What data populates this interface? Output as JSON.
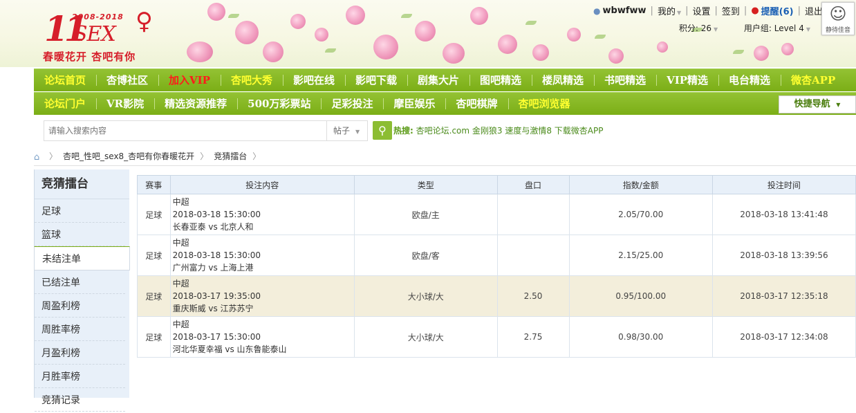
{
  "header": {
    "logo_number": "11",
    "logo_years": "2008-2018",
    "logo_text": "SEX",
    "slogan": "春暖花开 杏吧有你",
    "user": {
      "username": "wbwfww",
      "my_label": "我的",
      "settings_label": "设置",
      "checkin_label": "签到",
      "remind_label": "提醒(6)",
      "logout_label": "退出",
      "points": "积分: 26",
      "group": "用户组: Level 4",
      "avatar_caption": "静待佳音"
    }
  },
  "nav_primary": [
    {
      "label": "论坛首页",
      "color": "yellow"
    },
    {
      "label": "杏博社区",
      "color": "white"
    },
    {
      "label": "加入VIP",
      "color": "red"
    },
    {
      "label": "杏吧大秀",
      "color": "yellow"
    },
    {
      "label": "影吧在线",
      "color": "white"
    },
    {
      "label": "影吧下载",
      "color": "white"
    },
    {
      "label": "剧集大片",
      "color": "white"
    },
    {
      "label": "图吧精选",
      "color": "white"
    },
    {
      "label": "楼凤精选",
      "color": "white"
    },
    {
      "label": "书吧精选",
      "color": "white"
    },
    {
      "label": "VIP精选",
      "color": "white"
    },
    {
      "label": "电台精选",
      "color": "white"
    },
    {
      "label": "微杏APP",
      "color": "yellow"
    }
  ],
  "nav_secondary": [
    {
      "label": "论坛门户",
      "color": "yellow"
    },
    {
      "label": "VR影院",
      "color": "white"
    },
    {
      "label": "精选资源推荐",
      "color": "white"
    },
    {
      "label": "500万彩票站",
      "color": "white"
    },
    {
      "label": "足彩投注",
      "color": "white"
    },
    {
      "label": "摩臣娱乐",
      "color": "white"
    },
    {
      "label": "杏吧棋牌",
      "color": "white"
    },
    {
      "label": "杏吧浏览器",
      "color": "yellow"
    }
  ],
  "quick_nav_label": "快捷导航",
  "search": {
    "placeholder": "请输入搜索内容",
    "type_label": "帖子",
    "hot_label": "热搜:",
    "hot_words": "杏吧论坛.com 金刚狼3 速度与激情8 下载微杏APP"
  },
  "breadcrumb": [
    "杏吧_性吧_sex8_杏吧有你春暖花开",
    "竞猜擂台"
  ],
  "sidebar": {
    "title": "竞猜擂台",
    "items": [
      "足球",
      "篮球",
      "未结注单",
      "已结注单",
      "周盈利榜",
      "周胜率榜",
      "月盈利榜",
      "月胜率榜",
      "竞猜记录"
    ],
    "active_index": 2
  },
  "table": {
    "headers": [
      "赛事",
      "投注内容",
      "类型",
      "盘口",
      "指数/金额",
      "投注时间"
    ],
    "rows": [
      {
        "sport": "足球",
        "league": "中超",
        "match_time": "2018-03-18 15:30:00",
        "teams": "长春亚泰 vs 北京人和",
        "type": "欧盘/主",
        "handicap": "",
        "odds_amount": "2.05/70.00",
        "bet_time": "2018-03-18 13:41:48"
      },
      {
        "sport": "足球",
        "league": "中超",
        "match_time": "2018-03-18 15:30:00",
        "teams": "广州富力 vs 上海上港",
        "type": "欧盘/客",
        "handicap": "",
        "odds_amount": "2.15/25.00",
        "bet_time": "2018-03-18 13:39:56"
      },
      {
        "sport": "足球",
        "league": "中超",
        "match_time": "2018-03-17 19:35:00",
        "teams": "重庆斯威 vs 江苏苏宁",
        "type": "大小球/大",
        "handicap": "2.50",
        "odds_amount": "0.95/100.00",
        "bet_time": "2018-03-17 12:35:18"
      },
      {
        "sport": "足球",
        "league": "中超",
        "match_time": "2018-03-17 15:30:00",
        "teams": "河北华夏幸福 vs 山东鲁能泰山",
        "type": "大小球/大",
        "handicap": "2.75",
        "odds_amount": "0.98/30.00",
        "bet_time": "2018-03-17 12:34:08"
      }
    ],
    "highlight_index": 2
  }
}
